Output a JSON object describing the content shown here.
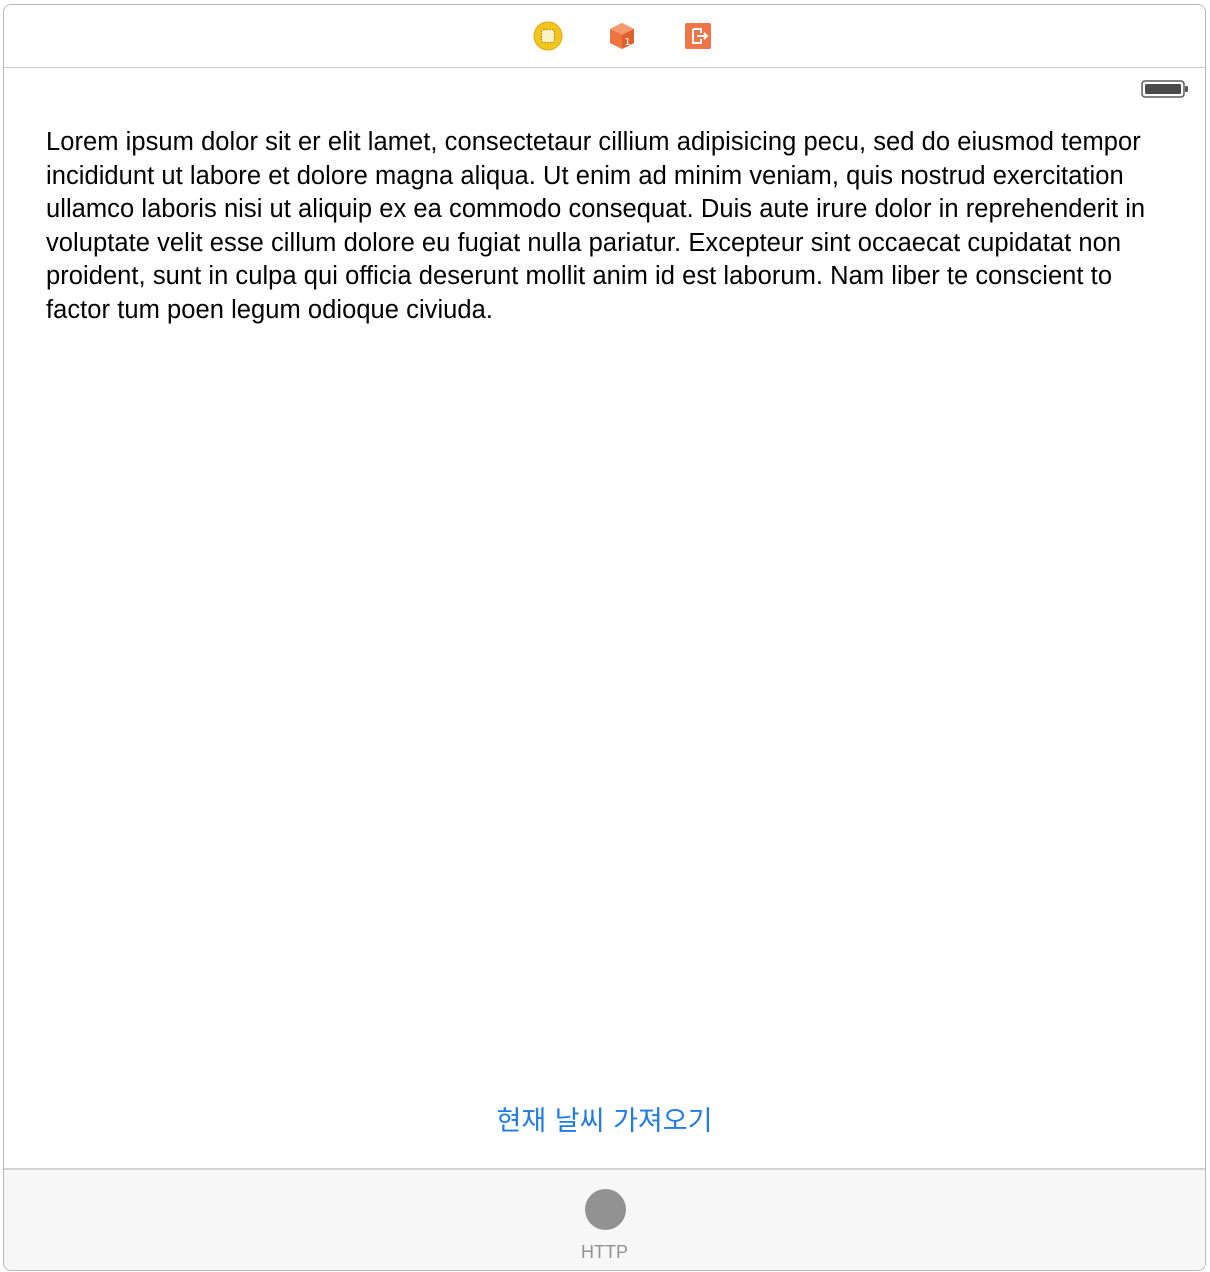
{
  "scene_dock": {
    "icons": [
      "view-controller-icon",
      "first-responder-icon",
      "exit-icon"
    ]
  },
  "status_bar": {
    "battery_level": 1.0
  },
  "main": {
    "text_view_content": "Lorem ipsum dolor sit er elit lamet, consectetaur cillium adipisicing pecu, sed do eiusmod tempor incididunt ut labore et dolore magna aliqua. Ut enim ad minim veniam, quis nostrud exercitation ullamco laboris nisi ut aliquip ex ea commodo consequat. Duis aute irure dolor in reprehenderit in voluptate velit esse cillum dolore eu fugiat nulla pariatur. Excepteur sint occaecat cupidatat non proident, sunt in culpa qui officia deserunt mollit anim id est laborum. Nam liber te conscient to factor tum poen legum odioque civiuda.",
    "fetch_button_label": "현재 날씨 가져오기"
  },
  "tab_bar": {
    "items": [
      {
        "label": "HTTP",
        "icon": "circle-tab-icon"
      }
    ]
  },
  "colors": {
    "accent": "#1f7be5",
    "tab_inactive": "#929292",
    "view_controller_icon": "#f3c51c",
    "first_responder_icon": "#ef7540",
    "exit_icon": "#f0764a"
  }
}
